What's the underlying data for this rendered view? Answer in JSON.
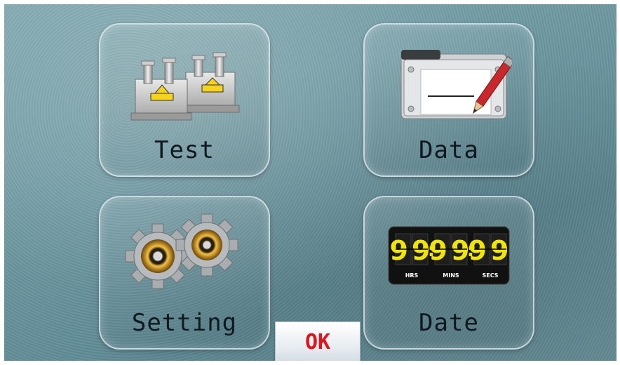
{
  "menu": {
    "test_label": "Test",
    "data_label": "Data",
    "setting_label": "Setting",
    "date_label": "Date"
  },
  "ok_label": "OK",
  "clock": {
    "hours": "99",
    "minutes": "99",
    "seconds": "99",
    "hrs_label": "HRS",
    "mins_label": "MINS",
    "secs_label": "SECS"
  },
  "icons": {
    "test": "electrical-components-icon",
    "data": "folder-pencil-icon",
    "setting": "gears-icon",
    "date": "flip-clock-icon"
  },
  "colors": {
    "ok_text": "#e0141a",
    "label_text": "#101820",
    "clock_digits": "#f2e600"
  }
}
